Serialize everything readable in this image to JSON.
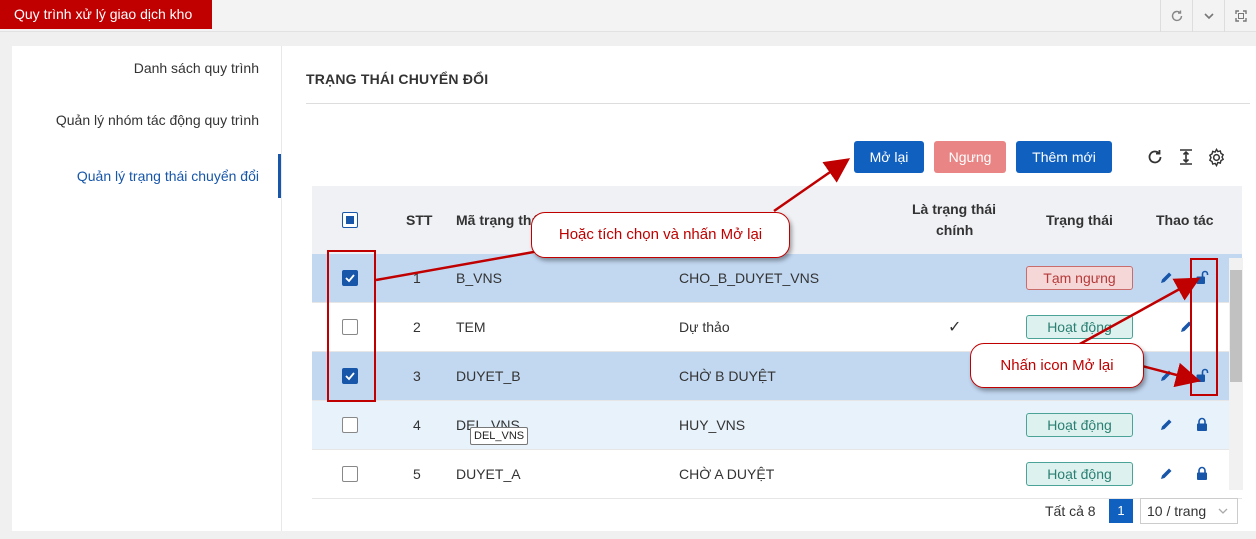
{
  "app": {
    "title": "Quy trình xử lý giao dịch kho"
  },
  "top_icons": [
    "refresh-icon",
    "chevron-down-icon",
    "fullscreen-icon"
  ],
  "sidebar": {
    "items": [
      {
        "label": "Danh sách quy trình",
        "active": false
      },
      {
        "label": "Quản lý nhóm tác động quy trình",
        "active": false
      },
      {
        "label": "Quản lý trạng thái chuyển đổi",
        "active": true
      }
    ]
  },
  "section": {
    "title": "TRẠNG THÁI CHUYỂN ĐỔI"
  },
  "toolbar": {
    "reopen_label": "Mở lại",
    "stop_label": "Ngưng",
    "add_label": "Thêm mới"
  },
  "table": {
    "headers": {
      "stt": "STT",
      "code": "Mã trạng thá",
      "main_1": "Là trạng thái",
      "main_2": "chính",
      "status": "Trạng thái",
      "actions": "Thao tác"
    },
    "rows": [
      {
        "checked": true,
        "stt": "1",
        "code": "B_VNS",
        "name": "CHO_B_DUYET_VNS",
        "main": "",
        "status": "Tạm ngưng",
        "status_type": "pause",
        "action_icon": "unlock-icon"
      },
      {
        "checked": false,
        "stt": "2",
        "code": "TEM",
        "name": "Dự thảo",
        "main": "✓",
        "status": "Hoạt động",
        "status_type": "active",
        "action_icon": "lock-icon"
      },
      {
        "checked": true,
        "stt": "3",
        "code": "DUYET_B",
        "name": "CHỜ B DUYỆT",
        "main": "",
        "status": "",
        "status_type": "pause",
        "action_icon": "unlock-icon"
      },
      {
        "checked": false,
        "stt": "4",
        "code": "DEL_VNS",
        "name": "HUY_VNS",
        "main": "",
        "status": "Hoạt động",
        "status_type": "active",
        "action_icon": "lock-icon"
      },
      {
        "checked": false,
        "stt": "5",
        "code": "DUYET_A",
        "name": "CHỜ A DUYỆT",
        "main": "",
        "status": "Hoạt động",
        "status_type": "active",
        "action_icon": "lock-icon"
      }
    ]
  },
  "tooltip": {
    "text": "DEL_VNS"
  },
  "pagination": {
    "total": "Tất cả 8",
    "page": "1",
    "page_size": "10 / trang"
  },
  "callouts": {
    "checkbox_hint": "Hoặc tích chọn và nhấn Mở lại",
    "icon_hint": "Nhấn icon Mở lại"
  },
  "colors": {
    "brand": "#c00000",
    "primary": "#1060c0",
    "selected_row": "#c2d8f1"
  }
}
